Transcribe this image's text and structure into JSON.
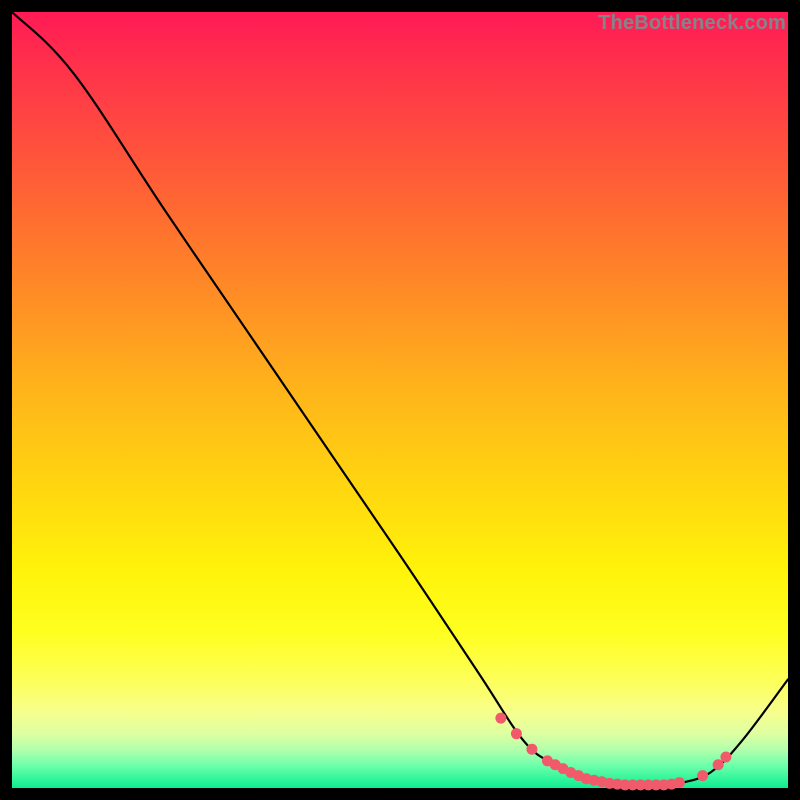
{
  "attribution": "TheBottleneck.com",
  "chart_data": {
    "type": "line",
    "title": "",
    "xlabel": "",
    "ylabel": "",
    "xlim": [
      0,
      100
    ],
    "ylim": [
      0,
      100
    ],
    "series": [
      {
        "name": "curve",
        "x": [
          0,
          8,
          20,
          35,
          50,
          60,
          66,
          70,
          74,
          78,
          82,
          84,
          86,
          90,
          94,
          100
        ],
        "y": [
          100,
          92,
          74,
          52,
          30,
          15,
          6,
          3,
          1,
          0.3,
          0.3,
          0.3,
          0.6,
          2,
          6,
          14
        ]
      }
    ],
    "markers": {
      "name": "highlight-dots",
      "color": "#f05a6a",
      "x": [
        63,
        65,
        67,
        69,
        70,
        71,
        72,
        73,
        74,
        75,
        76,
        77,
        78,
        79,
        80,
        81,
        82,
        83,
        84,
        85,
        86,
        89,
        91,
        92
      ],
      "y": [
        9,
        7,
        5,
        3.5,
        3,
        2.5,
        2,
        1.6,
        1.2,
        1,
        0.8,
        0.6,
        0.5,
        0.4,
        0.4,
        0.4,
        0.4,
        0.4,
        0.4,
        0.5,
        0.7,
        1.6,
        3,
        4
      ]
    }
  }
}
